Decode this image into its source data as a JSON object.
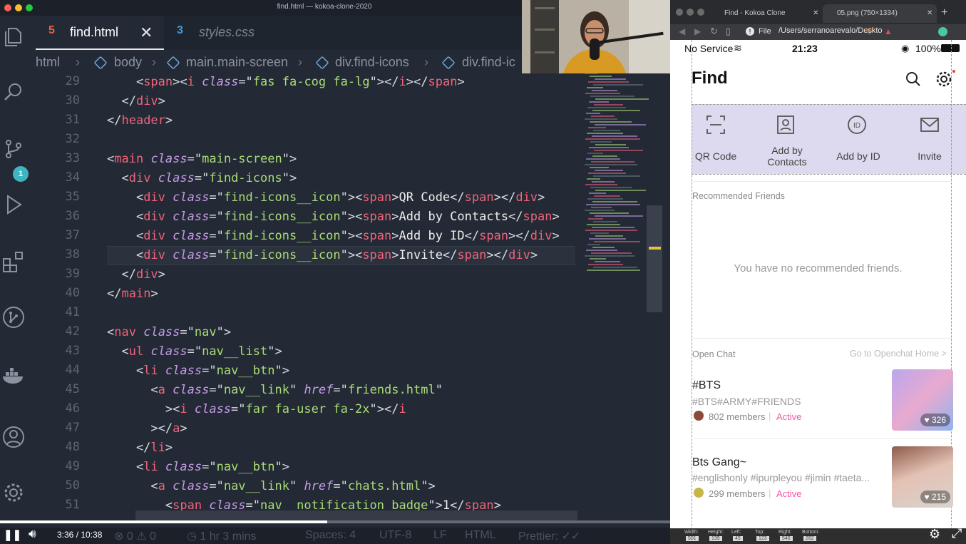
{
  "window": {
    "title": "find.html — kokoa-clone-2020"
  },
  "editor": {
    "tabs": [
      {
        "label": "find.html",
        "icon": "html5-icon",
        "active": true
      },
      {
        "label": "styles.css",
        "icon": "css3-icon",
        "active": false
      }
    ],
    "breadcrumb": [
      "html",
      "body",
      "main.main-screen",
      "div.find-icons",
      "div.find-ic"
    ],
    "scm_badge": "1",
    "line_numbers": [
      "29",
      "30",
      "31",
      "32",
      "33",
      "34",
      "35",
      "36",
      "37",
      "38",
      "39",
      "40",
      "41",
      "42",
      "43",
      "44",
      "45",
      "46",
      "47",
      "48",
      "49",
      "50",
      "51"
    ],
    "lines": [
      [
        [
          "pun",
          "    <"
        ],
        [
          "tag",
          "span"
        ],
        [
          "pun",
          "><"
        ],
        [
          "tag",
          "i"
        ],
        [
          "pun",
          " "
        ],
        [
          "att",
          "class"
        ],
        [
          "pun",
          "=\""
        ],
        [
          "str",
          "fas fa-cog fa-lg"
        ],
        [
          "pun",
          "\"></"
        ],
        [
          "tag",
          "i"
        ],
        [
          "pun",
          "></"
        ],
        [
          "tag",
          "span"
        ],
        [
          "pun",
          ">"
        ]
      ],
      [
        [
          "pun",
          "  </"
        ],
        [
          "tag",
          "div"
        ],
        [
          "pun",
          ">"
        ]
      ],
      [
        [
          "pun",
          "</"
        ],
        [
          "tag",
          "header"
        ],
        [
          "pun",
          ">"
        ]
      ],
      [],
      [
        [
          "pun",
          "<"
        ],
        [
          "tag",
          "main"
        ],
        [
          "pun",
          " "
        ],
        [
          "att",
          "class"
        ],
        [
          "pun",
          "=\""
        ],
        [
          "str",
          "main-screen"
        ],
        [
          "pun",
          "\">"
        ]
      ],
      [
        [
          "pun",
          "  <"
        ],
        [
          "tag",
          "div"
        ],
        [
          "pun",
          " "
        ],
        [
          "att",
          "class"
        ],
        [
          "pun",
          "=\""
        ],
        [
          "str",
          "find-icons"
        ],
        [
          "pun",
          "\">"
        ]
      ],
      [
        [
          "pun",
          "    <"
        ],
        [
          "tag",
          "div"
        ],
        [
          "pun",
          " "
        ],
        [
          "att",
          "class"
        ],
        [
          "pun",
          "=\""
        ],
        [
          "str",
          "find-icons__icon"
        ],
        [
          "pun",
          "\"><"
        ],
        [
          "tag",
          "span"
        ],
        [
          "pun",
          ">"
        ],
        [
          "txt",
          "QR Code"
        ],
        [
          "pun",
          "</"
        ],
        [
          "tag",
          "span"
        ],
        [
          "pun",
          "></"
        ],
        [
          "tag",
          "div"
        ],
        [
          "pun",
          ">"
        ]
      ],
      [
        [
          "pun",
          "    <"
        ],
        [
          "tag",
          "div"
        ],
        [
          "pun",
          " "
        ],
        [
          "att",
          "class"
        ],
        [
          "pun",
          "=\""
        ],
        [
          "str",
          "find-icons__icon"
        ],
        [
          "pun",
          "\"><"
        ],
        [
          "tag",
          "span"
        ],
        [
          "pun",
          ">"
        ],
        [
          "txt",
          "Add by Contacts"
        ],
        [
          "pun",
          "</"
        ],
        [
          "tag",
          "span"
        ],
        [
          "pun",
          ">"
        ]
      ],
      [
        [
          "pun",
          "    <"
        ],
        [
          "tag",
          "div"
        ],
        [
          "pun",
          " "
        ],
        [
          "att",
          "class"
        ],
        [
          "pun",
          "=\""
        ],
        [
          "str",
          "find-icons__icon"
        ],
        [
          "pun",
          "\"><"
        ],
        [
          "tag",
          "span"
        ],
        [
          "pun",
          ">"
        ],
        [
          "txt",
          "Add by ID"
        ],
        [
          "pun",
          "</"
        ],
        [
          "tag",
          "span"
        ],
        [
          "pun",
          "></"
        ],
        [
          "tag",
          "div"
        ],
        [
          "pun",
          ">"
        ]
      ],
      [
        [
          "pun",
          "    <"
        ],
        [
          "tag",
          "div"
        ],
        [
          "pun",
          " "
        ],
        [
          "att",
          "class"
        ],
        [
          "pun",
          "=\""
        ],
        [
          "str",
          "find-icons__icon"
        ],
        [
          "pun",
          "\"><"
        ],
        [
          "tag",
          "span"
        ],
        [
          "pun",
          ">"
        ],
        [
          "txt",
          "Invite"
        ],
        [
          "pun",
          "</"
        ],
        [
          "tag",
          "span"
        ],
        [
          "pun",
          "></"
        ],
        [
          "tag",
          "div"
        ],
        [
          "pun",
          ">"
        ]
      ],
      [
        [
          "pun",
          "  </"
        ],
        [
          "tag",
          "div"
        ],
        [
          "pun",
          ">"
        ]
      ],
      [
        [
          "pun",
          "</"
        ],
        [
          "tag",
          "main"
        ],
        [
          "pun",
          ">"
        ]
      ],
      [],
      [
        [
          "pun",
          "<"
        ],
        [
          "tag",
          "nav"
        ],
        [
          "pun",
          " "
        ],
        [
          "att",
          "class"
        ],
        [
          "pun",
          "=\""
        ],
        [
          "str",
          "nav"
        ],
        [
          "pun",
          "\">"
        ]
      ],
      [
        [
          "pun",
          "  <"
        ],
        [
          "tag",
          "ul"
        ],
        [
          "pun",
          " "
        ],
        [
          "att",
          "class"
        ],
        [
          "pun",
          "=\""
        ],
        [
          "str",
          "nav__list"
        ],
        [
          "pun",
          "\">"
        ]
      ],
      [
        [
          "pun",
          "    <"
        ],
        [
          "tag",
          "li"
        ],
        [
          "pun",
          " "
        ],
        [
          "att",
          "class"
        ],
        [
          "pun",
          "=\""
        ],
        [
          "str",
          "nav__btn"
        ],
        [
          "pun",
          "\">"
        ]
      ],
      [
        [
          "pun",
          "      <"
        ],
        [
          "tag",
          "a"
        ],
        [
          "pun",
          " "
        ],
        [
          "att",
          "class"
        ],
        [
          "pun",
          "=\""
        ],
        [
          "str",
          "nav__link"
        ],
        [
          "pun",
          "\" "
        ],
        [
          "att",
          "href"
        ],
        [
          "pun",
          "=\""
        ],
        [
          "str",
          "friends.html"
        ],
        [
          "pun",
          "\""
        ]
      ],
      [
        [
          "pun",
          "        ><"
        ],
        [
          "tag",
          "i"
        ],
        [
          "pun",
          " "
        ],
        [
          "att",
          "class"
        ],
        [
          "pun",
          "=\""
        ],
        [
          "str",
          "far fa-user fa-2x"
        ],
        [
          "pun",
          "\"></"
        ],
        [
          "tag",
          "i"
        ]
      ],
      [
        [
          "pun",
          "      ></"
        ],
        [
          "tag",
          "a"
        ],
        [
          "pun",
          ">"
        ]
      ],
      [
        [
          "pun",
          "    </"
        ],
        [
          "tag",
          "li"
        ],
        [
          "pun",
          ">"
        ]
      ],
      [
        [
          "pun",
          "    <"
        ],
        [
          "tag",
          "li"
        ],
        [
          "pun",
          " "
        ],
        [
          "att",
          "class"
        ],
        [
          "pun",
          "=\""
        ],
        [
          "str",
          "nav__btn"
        ],
        [
          "pun",
          "\">"
        ]
      ],
      [
        [
          "pun",
          "      <"
        ],
        [
          "tag",
          "a"
        ],
        [
          "pun",
          " "
        ],
        [
          "att",
          "class"
        ],
        [
          "pun",
          "=\""
        ],
        [
          "str",
          "nav__link"
        ],
        [
          "pun",
          "\" "
        ],
        [
          "att",
          "href"
        ],
        [
          "pun",
          "=\""
        ],
        [
          "str",
          "chats.html"
        ],
        [
          "pun",
          "\">"
        ]
      ],
      [
        [
          "pun",
          "        <"
        ],
        [
          "tag",
          "span"
        ],
        [
          "pun",
          " "
        ],
        [
          "att",
          "class"
        ],
        [
          "pun",
          "=\""
        ],
        [
          "str",
          "nav__notification badge"
        ],
        [
          "pun",
          "\">"
        ],
        [
          "txt",
          "1"
        ],
        [
          "pun",
          "</"
        ],
        [
          "tag",
          "span"
        ],
        [
          "pun",
          ">"
        ]
      ]
    ],
    "status": {
      "errors": "0",
      "warnings": "0",
      "time_tracker": "1 hr 3 mins",
      "spaces": "Spaces: 4",
      "encoding": "UTF-8",
      "eol": "LF",
      "language": "HTML",
      "prettier": "Prettier: ✓✓"
    }
  },
  "browser": {
    "tabs": [
      {
        "label": "Find - Kokoa Clone"
      },
      {
        "label": "05.png (750×1334)"
      }
    ],
    "address": {
      "scheme": "File",
      "url": "/Users/serranoarevalo/Deskto"
    }
  },
  "phone": {
    "status": {
      "carrier": "No Service",
      "time": "21:23",
      "battery": "100%"
    },
    "title": "Find",
    "find_icons": [
      {
        "label": "QR Code",
        "icon": "qr-scan-icon"
      },
      {
        "label": "Add by\nContacts",
        "icon": "contact-card-icon"
      },
      {
        "label": "Add by ID",
        "icon": "id-badge-icon"
      },
      {
        "label": "Invite",
        "icon": "envelope-icon"
      }
    ],
    "recommended": {
      "heading": "Recommended Friends",
      "empty": "You have no recommended friends."
    },
    "open_chat": {
      "heading": "Open Chat",
      "link": "Go to Openchat Home >",
      "items": [
        {
          "name": "#BTS",
          "tags": "#BTS#ARMY#FRIENDS",
          "members": "802 members",
          "status": "Active",
          "likes": "326"
        },
        {
          "name": "Bts Gang~",
          "tags": "#englishonly #ipurpleyou #jimin #taeta...",
          "members": "299 members",
          "status": "Active",
          "likes": "215"
        }
      ]
    },
    "devtools": {
      "labels": [
        "Width:",
        "Height:",
        "Left:",
        "Top:",
        "Right:",
        "Bottom:"
      ],
      "values": [
        "501",
        "139",
        "45",
        "123",
        "546",
        "262"
      ]
    }
  },
  "player": {
    "current": "3:36",
    "duration": "10:38",
    "progress": 0.339,
    "label": "3:36 / 10:38"
  },
  "colors": {
    "accent_active": "#f357a5",
    "find_strip": "#ddd9ee",
    "badge": "#3eb6c2"
  }
}
